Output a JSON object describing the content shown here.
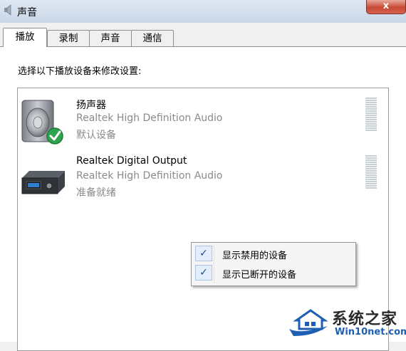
{
  "window": {
    "title": "声音",
    "close_glyph": "x"
  },
  "tabs": [
    {
      "label": "播放",
      "active": true
    },
    {
      "label": "录制",
      "active": false
    },
    {
      "label": "声音",
      "active": false
    },
    {
      "label": "通信",
      "active": false
    }
  ],
  "instruction": "选择以下播放设备来修改设置:",
  "devices": [
    {
      "name": "扬声器",
      "description": "Realtek High Definition Audio",
      "status": "默认设备",
      "icon": "speaker-icon",
      "default_badge": "green-check"
    },
    {
      "name": "Realtek Digital Output",
      "description": "Realtek High Definition Audio",
      "status": "准备就绪",
      "icon": "digital-output-icon"
    }
  ],
  "context_menu": {
    "items": [
      {
        "label": "显示禁用的设备",
        "checked": true,
        "check_glyph": "✓"
      },
      {
        "label": "显示已断开的设备",
        "checked": true,
        "check_glyph": "✓"
      }
    ]
  },
  "watermark": {
    "title": "系统之家",
    "url": "Win10net.com"
  },
  "colors": {
    "accent": "#1e5fb3",
    "check_green": "#2da44e",
    "secondary_text": "#8a8a8a"
  }
}
